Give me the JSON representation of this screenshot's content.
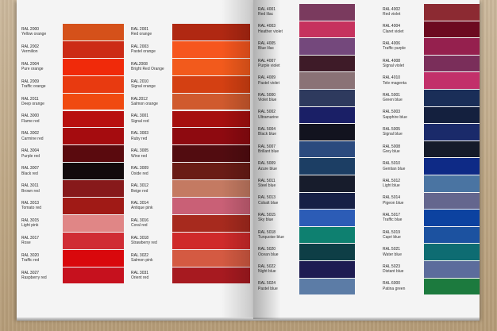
{
  "left_page": {
    "columns": [
      {
        "chips": [
          {
            "code": "RAL 2000",
            "name": "Yellow orange",
            "color": "#D5511A"
          },
          {
            "code": "RAL 2002",
            "name": "Vermilion",
            "color": "#CC2B16"
          },
          {
            "code": "RAL 2004",
            "name": "Pure orange",
            "color": "#F02A0A"
          },
          {
            "code": "RAL 2009",
            "name": "Traffic orange",
            "color": "#E83A10"
          },
          {
            "code": "RAL 2011",
            "name": "Deep orange",
            "color": "#F04A10"
          },
          {
            "code": "RAL 3000",
            "name": "Flame red",
            "color": "#B8100F"
          },
          {
            "code": "RAL 3002",
            "name": "Carmine red",
            "color": "#A50C0F"
          },
          {
            "code": "RAL 3004",
            "name": "Purple red",
            "color": "#5A0A0E"
          },
          {
            "code": "RAL 3007",
            "name": "Black red",
            "color": "#120A0C"
          },
          {
            "code": "RAL 3011",
            "name": "Brown red",
            "color": "#87191B"
          },
          {
            "code": "RAL 3013",
            "name": "Tomato red",
            "color": "#A01A16"
          },
          {
            "code": "RAL 3015",
            "name": "Light pink",
            "color": "#E08686"
          },
          {
            "code": "RAL 3017",
            "name": "Rose",
            "color": "#D02C34"
          },
          {
            "code": "RAL 3020",
            "name": "Traffic red",
            "color": "#D9080C"
          },
          {
            "code": "RAL 3027",
            "name": "Raspberry red",
            "color": "#C6111E"
          }
        ]
      },
      {
        "chips": [
          {
            "code": "RAL 2001",
            "name": "Red orange",
            "color": "#B02812"
          },
          {
            "code": "RAL 2003",
            "name": "Pastel orange",
            "color": "#F6561E"
          },
          {
            "code": "RAL2008",
            "name": "Bright Red Orange",
            "color": "#F25A1C"
          },
          {
            "code": "RAL 2010",
            "name": "Signal orange",
            "color": "#D44012"
          },
          {
            "code": "RAL2012",
            "name": "Salmon orange",
            "color": "#D05A2E"
          },
          {
            "code": "RAL 3001",
            "name": "Signal red",
            "color": "#A6100F"
          },
          {
            "code": "RAL 3003",
            "name": "Ruby red",
            "color": "#8E0A10"
          },
          {
            "code": "RAL 3005",
            "name": "Wine red",
            "color": "#520C10"
          },
          {
            "code": "RAL 3009",
            "name": "Oxide red",
            "color": "#6A1C16"
          },
          {
            "code": "RAL 3012",
            "name": "Beige red",
            "color": "#C47A62"
          },
          {
            "code": "RAL 3014",
            "name": "Antique pink",
            "color": "#C96076"
          },
          {
            "code": "RAL 3016",
            "name": "Coral red",
            "color": "#A72A1E"
          },
          {
            "code": "RAL 3018",
            "name": "Strawberry red",
            "color": "#CF2A2A"
          },
          {
            "code": "RAL 3022",
            "name": "Salmon pink",
            "color": "#D45A42"
          },
          {
            "code": "RAL 3031",
            "name": "Orient red",
            "color": "#A71A20"
          }
        ]
      }
    ]
  },
  "right_page": {
    "columns": [
      {
        "chips": [
          {
            "code": "RAL 4001",
            "name": "Red lilac",
            "color": "#7A3A5E"
          },
          {
            "code": "RAL 4003",
            "name": "Heather violet",
            "color": "#C6325E"
          },
          {
            "code": "RAL 4005",
            "name": "Blue lilac",
            "color": "#74487C"
          },
          {
            "code": "RAL 4007",
            "name": "Purple violet",
            "color": "#3E1B28"
          },
          {
            "code": "RAL 4009",
            "name": "Pastel violet",
            "color": "#8A7276"
          },
          {
            "code": "RAL 5000",
            "name": "Violet blue",
            "color": "#2E3A5E"
          },
          {
            "code": "RAL 5002",
            "name": "Ultramarine",
            "color": "#1A1F66"
          },
          {
            "code": "RAL 5004",
            "name": "Black blue",
            "color": "#12131F"
          },
          {
            "code": "RAL 5007",
            "name": "Brillant blue",
            "color": "#2B4A7E"
          },
          {
            "code": "RAL 5009",
            "name": "Azure blue",
            "color": "#1C3E64"
          },
          {
            "code": "RAL 5011",
            "name": "Steel blue",
            "color": "#171C2C"
          },
          {
            "code": "RAL 5013",
            "name": "Cobalt blue",
            "color": "#162046"
          },
          {
            "code": "RAL 5015",
            "name": "Sky blue",
            "color": "#2C5CB6"
          },
          {
            "code": "RAL 5018",
            "name": "Turquoise blue",
            "color": "#0E8070"
          },
          {
            "code": "RAL 5020",
            "name": "Ocean blue",
            "color": "#0E3E46"
          },
          {
            "code": "RAL 5022",
            "name": "Night blue",
            "color": "#1E1C52"
          },
          {
            "code": "RAL 5024",
            "name": "Pastel blue",
            "color": "#5C7CA6"
          }
        ]
      },
      {
        "chips": [
          {
            "code": "RAL 4002",
            "name": "Red violet",
            "color": "#8C2A32"
          },
          {
            "code": "RAL 4004",
            "name": "Claret violet",
            "color": "#6C0A20"
          },
          {
            "code": "RAL 4006",
            "name": "Traffic purple",
            "color": "#95204E"
          },
          {
            "code": "RAL 4008",
            "name": "Signal violet",
            "color": "#7A2E5A"
          },
          {
            "code": "RAL 4010",
            "name": "Tele magenta",
            "color": "#C2306A"
          },
          {
            "code": "RAL 5001",
            "name": "Green blue",
            "color": "#1A2E58"
          },
          {
            "code": "RAL 5003",
            "name": "Sapphire blue",
            "color": "#14203E"
          },
          {
            "code": "RAL 5005",
            "name": "Signal blue",
            "color": "#1A2A6A"
          },
          {
            "code": "RAL 5008",
            "name": "Grey blue",
            "color": "#151B2A"
          },
          {
            "code": "RAL 5010",
            "name": "Gentian blue",
            "color": "#0E2A86"
          },
          {
            "code": "RAL 5012",
            "name": "Light blue",
            "color": "#4A74A2"
          },
          {
            "code": "RAL 5014",
            "name": "Pigeon blue",
            "color": "#64668E"
          },
          {
            "code": "RAL 5017",
            "name": "Traffic blue",
            "color": "#0C42A0"
          },
          {
            "code": "RAL 5019",
            "name": "Capri blue",
            "color": "#1C52A0"
          },
          {
            "code": "RAL 5021",
            "name": "Water blue",
            "color": "#0E6C72"
          },
          {
            "code": "RAL 5023",
            "name": "Distant blue",
            "color": "#5C6C9C"
          },
          {
            "code": "RAL 6000",
            "name": "Patina green",
            "color": "#1C7A3E"
          }
        ]
      }
    ]
  }
}
